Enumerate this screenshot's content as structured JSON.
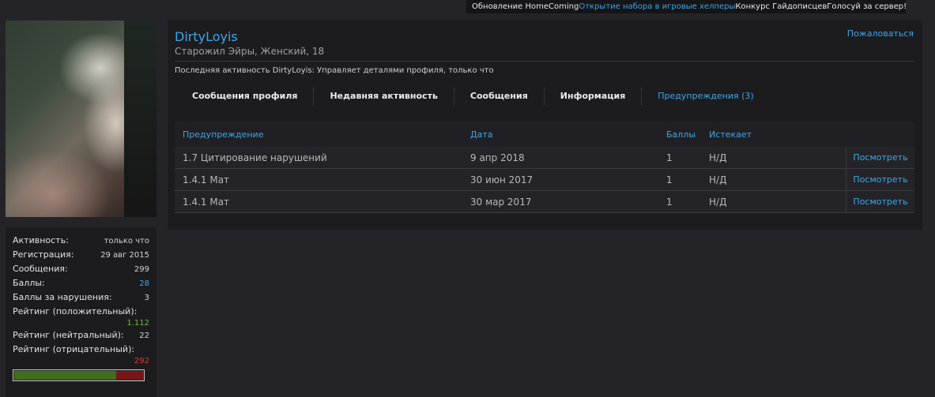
{
  "topbar": {
    "links": [
      {
        "label": "Обновление HomeComing",
        "highlight": false
      },
      {
        "label": "Открытие набора в игровые хелперы",
        "highlight": true
      },
      {
        "label": "Конкурс Гайдописцев",
        "highlight": false
      },
      {
        "label": "Голосуй за сервер!",
        "highlight": false
      }
    ]
  },
  "profile": {
    "username": "DirtyLoyis",
    "title": "Старожил Эйры, Женский, 18",
    "report_label": "Пожаловаться",
    "last_activity": "Последняя активность DirtyLoyis: Управляет деталями профиля, только что"
  },
  "tabs": [
    {
      "label": "Сообщения профиля",
      "active": false
    },
    {
      "label": "Недавняя активность",
      "active": false
    },
    {
      "label": "Сообщения",
      "active": false
    },
    {
      "label": "Информация",
      "active": false
    },
    {
      "label": "Предупреждения (3)",
      "active": true
    }
  ],
  "warnings": {
    "headers": {
      "warning": "Предупреждение",
      "date": "Дата",
      "points": "Баллы",
      "expires": "Истекает"
    },
    "view_label": "Посмотреть",
    "rows": [
      {
        "warning": "1.7 Цитирование нарушений",
        "date": "9 апр 2018",
        "points": "1",
        "expires": "Н/Д"
      },
      {
        "warning": "1.4.1 Мат",
        "date": "30 июн 2017",
        "points": "1",
        "expires": "Н/Д"
      },
      {
        "warning": "1.4.1 Мат",
        "date": "30 мар 2017",
        "points": "1",
        "expires": "Н/Д"
      }
    ]
  },
  "stats": {
    "activity": {
      "label": "Активность:",
      "value": "только что"
    },
    "registration": {
      "label": "Регистрация:",
      "value": "29 авг 2015"
    },
    "messages": {
      "label": "Сообщения:",
      "value": "299"
    },
    "points": {
      "label": "Баллы:",
      "value": "28"
    },
    "violation_points": {
      "label": "Баллы за нарушения:",
      "value": "3"
    },
    "rating_positive": {
      "label": "Рейтинг (положительный):",
      "value": "1.112"
    },
    "rating_neutral": {
      "label": "Рейтинг (нейтральный):",
      "value": "22"
    },
    "rating_negative": {
      "label": "Рейтинг (отрицательный):",
      "value": "292"
    },
    "rating_positive_fraction": 0.79
  },
  "colors": {
    "accent": "#3ea6e8",
    "positive": "#6dbb3a",
    "negative": "#e23a3a"
  }
}
